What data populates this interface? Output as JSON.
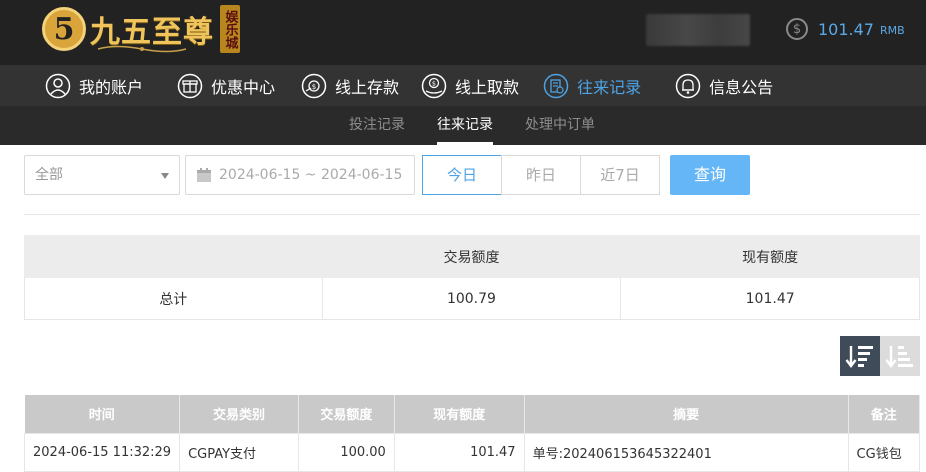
{
  "header": {
    "logo_mark": "5",
    "logo_text": "九五至尊",
    "logo_seal": "娱乐城",
    "balance_value": "101.47",
    "balance_unit": "RMB",
    "coin_symbol": "$"
  },
  "nav": {
    "items": [
      {
        "label": "我的账户",
        "icon": "user-icon"
      },
      {
        "label": "优惠中心",
        "icon": "gift-icon"
      },
      {
        "label": "线上存款",
        "icon": "deposit-icon"
      },
      {
        "label": "线上取款",
        "icon": "withdraw-icon"
      },
      {
        "label": "往来记录",
        "icon": "records-icon",
        "active": true
      },
      {
        "label": "信息公告",
        "icon": "bell-icon"
      }
    ],
    "active_color": "#4ea3e4"
  },
  "subnav": {
    "items": [
      {
        "label": "投注记录"
      },
      {
        "label": "往来记录",
        "active": true
      },
      {
        "label": "处理中订单"
      }
    ]
  },
  "filters": {
    "type_select": "全部",
    "date_range": "2024-06-15 ~ 2024-06-15",
    "segments": [
      {
        "label": "今日",
        "active": true
      },
      {
        "label": "昨日"
      },
      {
        "label": "近7日"
      }
    ],
    "query_label": "查询"
  },
  "summary": {
    "headers": [
      "",
      "交易额度",
      "现有额度"
    ],
    "row": [
      "总计",
      "100.79",
      "101.47"
    ]
  },
  "records": {
    "headers": [
      "时间",
      "交易类别",
      "交易额度",
      "现有额度",
      "摘要",
      "备注"
    ],
    "rows": [
      [
        "2024-06-15 11:32:29",
        "CGPAY支付",
        "100.00",
        "101.47",
        "单号:202406153645322401",
        "CG钱包"
      ]
    ]
  },
  "colors": {
    "topbar": "#222222",
    "nav_bg": "#333333",
    "query_button": "#64b6f7",
    "sort_active": "#3f4b59"
  }
}
